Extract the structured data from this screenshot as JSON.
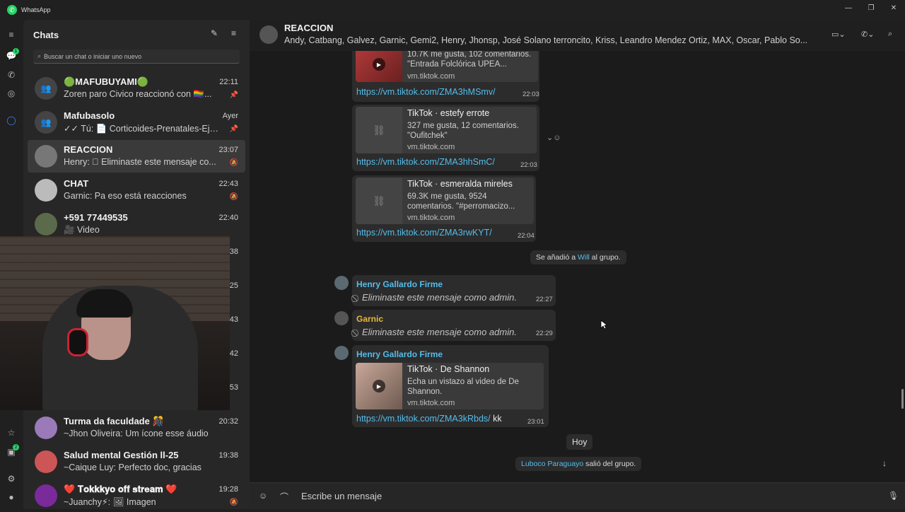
{
  "app": {
    "title": "WhatsApp"
  },
  "window_controls": {
    "minimize": "—",
    "maximize": "❐",
    "close": "✕"
  },
  "rail": {
    "chats_badge": "1",
    "status_badge": "2"
  },
  "sidebar": {
    "title": "Chats",
    "search_placeholder": "Buscar un chat o iniciar uno nuevo",
    "chats": [
      {
        "name": "🟢MAFUBUYAMI🟢",
        "time": "22:11",
        "preview": "Zoren paro Civico reaccionó con 🏳️‍🌈...",
        "pinned": "📌"
      },
      {
        "name": "Mafubasolo",
        "time": "Ayer",
        "preview": "✓✓ Tú: 📄 Corticoides-Prenatales-Eje-...",
        "pinned": "📌"
      },
      {
        "name": "REACCION",
        "time": "23:07",
        "preview": "Henry: ⃠ Eliminaste este mensaje co...",
        "muted": "🔕"
      },
      {
        "name": "CHAT",
        "time": "22:43",
        "preview": "Garnic: Pa eso está reacciones",
        "muted": "🔕"
      },
      {
        "name": "+591 77449535",
        "time": "22:40",
        "preview": "🎥 Video"
      },
      {
        "time": "38"
      },
      {
        "time": "25"
      },
      {
        "time": "43"
      },
      {
        "time": "42"
      },
      {
        "time": "53"
      },
      {
        "name": "Turma da faculdade 🎊",
        "time": "20:32",
        "preview": "~Jhon Oliveira: Um ícone esse áudio"
      },
      {
        "name": "Salud mental Gestión ll-25",
        "time": "19:38",
        "preview": "~Caique Luy: Perfecto doc, gracias"
      },
      {
        "name": "❤️ 𝐓𝐨𝐤𝐤𝐤𝐲𝐨 𝐨𝐟𝐟 𝐬𝐭𝐫𝐞𝐚𝐦 ❤️",
        "time": "19:28",
        "preview": "~Juanchy⚡: 🖼 Imagen",
        "muted": "🔕"
      }
    ]
  },
  "header": {
    "group_name": "REACCION",
    "members": "Andy, Catbang, Galvez, Garnic, Gemi2, Henry, Jhonsp, José Solano terroncito, Kriss, Leandro Mendez Ortiz, MAX, Oscar, Pablo So..."
  },
  "messages": {
    "m1": {
      "desc": "10.7K me gusta, 102 comentarios. \"Entrada Folclórica UPEA...",
      "domain": "vm.tiktok.com",
      "url": "https://vm.tiktok.com/ZMA3hMSmv/",
      "time": "22:03"
    },
    "m2": {
      "title": "TikTok · estefy errote",
      "desc": "327 me gusta, 12 comentarios. \"Oufitchek\"",
      "domain": "vm.tiktok.com",
      "url": "https://vm.tiktok.com/ZMA3hhSmC/",
      "time": "22:03"
    },
    "m3": {
      "title": "TikTok · esmeralda mireles",
      "desc": "69.3K me gusta, 9524 comentarios. \"#perromacizo...",
      "domain": "vm.tiktok.com",
      "url": "https://vm.tiktok.com/ZMA3rwKYT/",
      "time": "22:04"
    },
    "sys1": {
      "pre": "Se añadió a ",
      "who": "Will",
      "post": " al grupo."
    },
    "m4": {
      "sender": "Henry Gallardo Firme",
      "text": "Eliminaste este mensaje como admin.",
      "time": "22:27"
    },
    "m5": {
      "sender": "Garnic",
      "text": "Eliminaste este mensaje como admin.",
      "time": "22:29"
    },
    "m6": {
      "sender": "Henry Gallardo Firme",
      "title": "TikTok · De Shannon",
      "desc": "Echa un vistazo al video de De Shannon.",
      "domain": "vm.tiktok.com",
      "url": "https://vm.tiktok.com/ZMA3kRbds/",
      "extra": " kk",
      "time": "23:01"
    },
    "date_chip": "Hoy",
    "sys2": {
      "who": "Luboco Paraguayo",
      "post": " salió del grupo."
    }
  },
  "composer": {
    "placeholder": "Escribe un mensaje"
  },
  "colors": {
    "accent": "#25d366",
    "link": "#53bdeb",
    "henry": "#53bdeb",
    "garnic": "#e8b838"
  }
}
